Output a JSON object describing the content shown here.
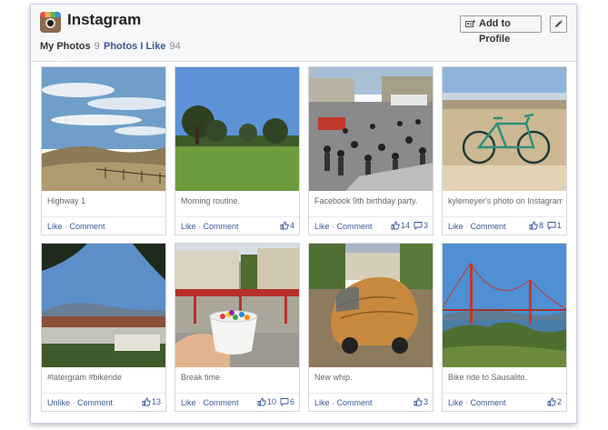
{
  "header": {
    "title": "Instagram",
    "add_button_label": "Add to Profile"
  },
  "tabs": [
    {
      "label": "My Photos",
      "count": "9"
    },
    {
      "label": "Photos I Like",
      "count": "94"
    }
  ],
  "photos": [
    {
      "caption": "Highway 1",
      "like_action": "Like",
      "comment_action": "Comment",
      "likes": "",
      "comments": "",
      "subject": "landscape-hills"
    },
    {
      "caption": "Morning routine.",
      "like_action": "Like",
      "comment_action": "Comment",
      "likes": "4",
      "comments": "",
      "subject": "field-trees"
    },
    {
      "caption": "Facebook 9th birthday party.",
      "like_action": "Like",
      "comment_action": "Comment",
      "likes": "14",
      "comments": "3",
      "subject": "crowd-party"
    },
    {
      "caption": "kylemeyer's photo on Instagram",
      "like_action": "Like",
      "comment_action": "Comment",
      "likes": "8",
      "comments": "1",
      "subject": "bicycle-wall"
    },
    {
      "caption": "#latergram #bikeride",
      "like_action": "Unlike",
      "comment_action": "Comment",
      "likes": "13",
      "comments": "",
      "subject": "bay-view"
    },
    {
      "caption": "Break time",
      "like_action": "Like",
      "comment_action": "Comment",
      "likes": "10",
      "comments": "6",
      "subject": "candy-cup"
    },
    {
      "caption": "New whip.",
      "like_action": "Like",
      "comment_action": "Comment",
      "likes": "3",
      "comments": "",
      "subject": "wooden-car"
    },
    {
      "caption": "Bike ride to Sausalito.",
      "like_action": "Like",
      "comment_action": "Comment",
      "likes": "2",
      "comments": "",
      "subject": "golden-gate-bridge"
    }
  ],
  "colors": {
    "link": "#3b5998",
    "border": "#d3d6db"
  },
  "icons": [
    "instagram-logo-icon",
    "add-profile-icon",
    "pencil-icon",
    "thumbs-up-icon",
    "comment-bubble-icon"
  ]
}
